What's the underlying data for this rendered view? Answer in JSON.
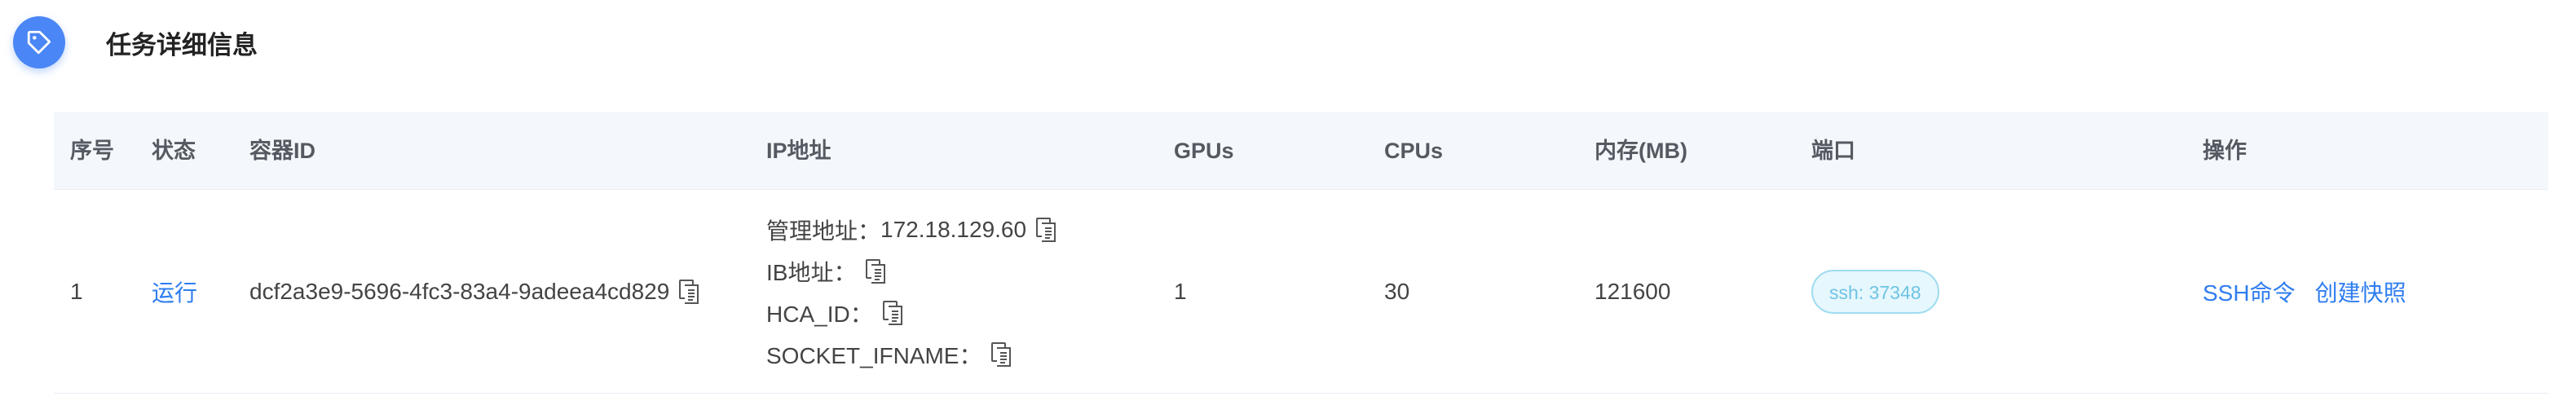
{
  "header": {
    "title": "任务详细信息",
    "icon": "tag-icon",
    "accent": "#4a86f5"
  },
  "table": {
    "columns": [
      "序号",
      "状态",
      "容器ID",
      "IP地址",
      "GPUs",
      "CPUs",
      "内存(MB)",
      "端口",
      "操作"
    ],
    "rows": [
      {
        "index": "1",
        "status": "运行",
        "container_id": "dcf2a3e9-5696-4fc3-83a4-9adeea4cd829",
        "ip": {
          "manage_label": "管理地址：",
          "manage_value": "172.18.129.60",
          "ib_label": "IB地址：",
          "ib_value": "",
          "hca_label": "HCA_ID：",
          "hca_value": "",
          "socket_label": "SOCKET_IFNAME：",
          "socket_value": ""
        },
        "gpus": "1",
        "cpus": "30",
        "memory": "121600",
        "port": "ssh: 37348",
        "actions": [
          "SSH命令",
          "创建快照"
        ]
      }
    ]
  },
  "colors": {
    "link": "#2f7df0",
    "header_bg": "#f4f8fd",
    "badge_border": "#9fdcf0",
    "badge_bg": "#e6f7fd",
    "badge_text": "#6fc4e4"
  }
}
